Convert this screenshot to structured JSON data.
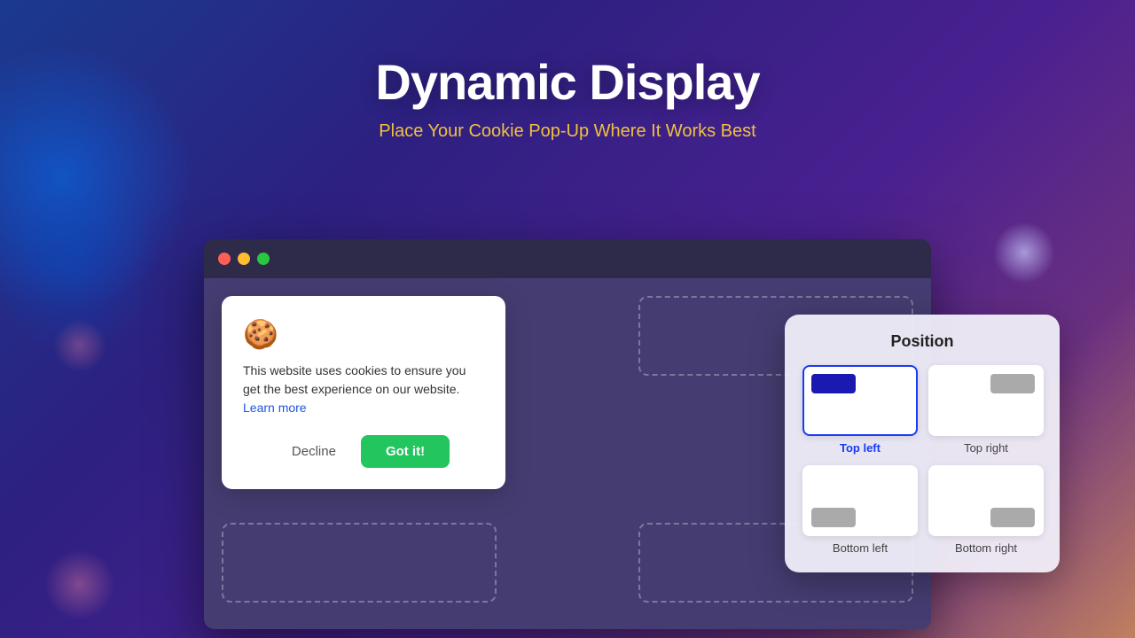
{
  "page": {
    "title": "Dynamic Display",
    "subtitle": "Place Your Cookie Pop-Up Where It Works Best"
  },
  "browser": {
    "traffic_lights": [
      "red",
      "yellow",
      "green"
    ]
  },
  "cookie_popup": {
    "icon": "🍪",
    "text": "This website uses cookies to ensure you get the best experience on our website.",
    "learn_more": "Learn more",
    "decline_label": "Decline",
    "gotit_label": "Got it!"
  },
  "position_panel": {
    "title": "Position",
    "options": [
      {
        "id": "top-left",
        "label": "Top left",
        "active": true
      },
      {
        "id": "top-right",
        "label": "Top right",
        "active": false
      },
      {
        "id": "bottom-left",
        "label": "Bottom left",
        "active": false
      },
      {
        "id": "bottom-right",
        "label": "Bottom right",
        "active": false
      }
    ]
  },
  "colors": {
    "accent_blue": "#1a3af5",
    "green_btn": "#22c55e",
    "title_yellow": "#f0c040"
  }
}
